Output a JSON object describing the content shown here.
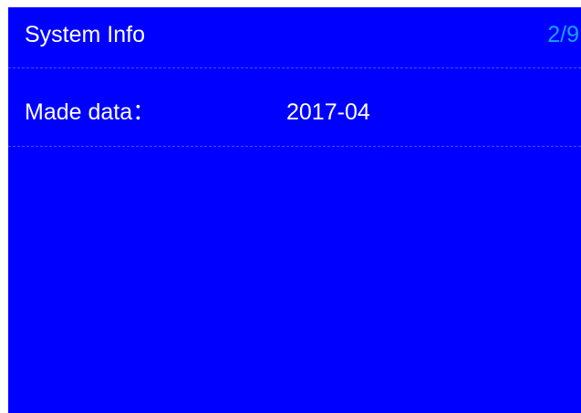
{
  "header": {
    "title": "System Info",
    "page_indicator": "2/9"
  },
  "info": {
    "made_date_label": "Made data：",
    "made_date_value": "2017-04"
  },
  "colors": {
    "screen_background": "#0000ff",
    "text": "#ffffff",
    "page_indicator": "#1aa3ff",
    "divider": "#4b4bff"
  }
}
